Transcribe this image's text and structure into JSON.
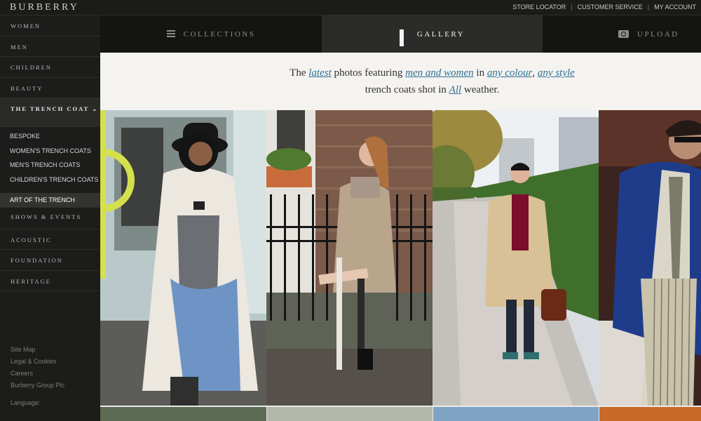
{
  "brand": "BURBERRY",
  "top_links": [
    "STORE LOCATOR",
    "CUSTOMER SERVICE",
    "MY ACCOUNT"
  ],
  "sidebar": {
    "items": [
      "WOMEN",
      "MEN",
      "CHILDREN",
      "BEAUTY"
    ],
    "active": "THE TRENCH COAT",
    "sub_items": [
      "BESPOKE",
      "WOMEN'S TRENCH COATS",
      "MEN'S TRENCH COATS",
      "CHILDREN'S TRENCH COATS",
      "ART OF THE TRENCH"
    ],
    "items_after": [
      "SHOWS & EVENTS",
      "ACOUSTIC",
      "FOUNDATION",
      "HERITAGE"
    ],
    "footer": [
      "Site Map",
      "Legal & Cookies",
      "Careers",
      "Burberry Group Plc"
    ],
    "language": "Language:"
  },
  "tabs": [
    {
      "label": "COLLECTIONS",
      "icon": "list-icon"
    },
    {
      "label": "GALLERY",
      "icon": "grid-icon"
    },
    {
      "label": "UPLOAD",
      "icon": "camera-icon"
    }
  ],
  "intro": {
    "t1": "The ",
    "latest": "latest",
    "t2": " photos featuring ",
    "men_women": "men and women",
    "t3": " in ",
    "colour": "any colour",
    "t4": ", ",
    "style": "any style",
    "t5": "trench coats shot in ",
    "all": "All",
    "t6": " weather."
  },
  "colors": {
    "link": "#2b6f96",
    "sidebar_bg": "#1c1c1b",
    "active_tab": "#2b2b29",
    "intro_bg": "#f5f3f0"
  }
}
